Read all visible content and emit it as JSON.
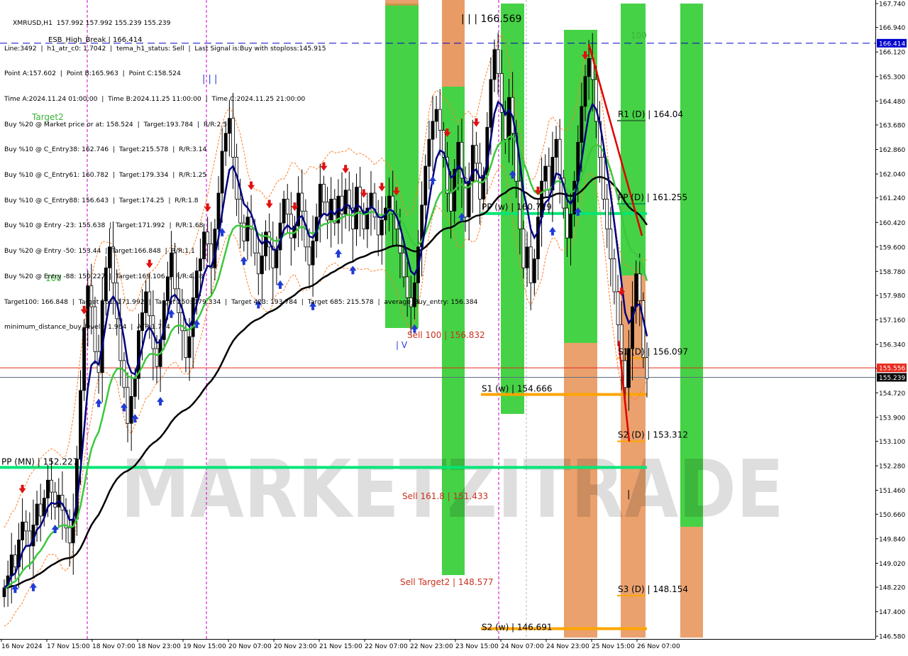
{
  "window": {
    "symbol_title": "XMRUSD,H1  157.992 157.992 155.239 155.239"
  },
  "info_panel": [
    "Line:3492  |  h1_atr_c0: 1.7042  |  tema_h1_status: Sell  |  Last Signal is:Buy with stoploss:145.915",
    "Point A:157.602  |  Point B:165.963  |  Point C:158.524",
    "Time A:2024.11.24 01:00:00  |  Time B:2024.11.25 11:00:00  |  Time C:2024.11.25 21:00:00",
    "Buy %20 @ Market price or at: 158.524  |  Target:193.784  |  R/R:2.57",
    "Buy %10 @ C_Entry38: 162.746  |  Target:215.578  |  R/R:3.14",
    "Buy %10 @ C_Entry61: 160.782  |  Target:179.334  |  R/R:1.25",
    "Buy %10 @ C_Entry88: 156.643  |  Target:174.25  |  R/R:1.8",
    "Buy %10 @ Entry -23: 155.638  |  Target:171.992  |  R/R:1.68",
    "Buy %20 @ Entry -50: 153.44  |  Target:166.848  |  R/R:1.1",
    "Buy %20 @ Entry -88: 150.227  |  Target:169.106  |  R/R:4.38",
    "Target100: 166.848  |  Target 161: 171.992  |  Target 250: 179.334  |  Target 423: 193.784  |  Target 685: 215.578  |  average_Buy_entry: 156.384",
    "minimum_distance_buy_levels: 1.964  |  ATR:1.704"
  ],
  "watermark": "MARKETZITRADE",
  "colors": {
    "background": "#ffffff",
    "bull_candle": "#000000",
    "green_zone": "#32cd32",
    "orange_zone": "#e5894a",
    "pivot_line": "#00e676",
    "support_line": "#ffa500",
    "ema_blue": "#00007f",
    "ma_green": "#3cc83c",
    "ma_black": "#000000",
    "trend_red": "#e00000",
    "band_orange": "#ff7f27",
    "sell_text": "#c8321e",
    "current_price_red": "#e8291c",
    "bid_line": "#5a6e82",
    "high_line_blue": "#0000cd"
  },
  "chart_data": {
    "type": "candlestick",
    "symbol": "XMRUSD",
    "timeframe": "H1",
    "ylim": [
      146.56,
      167.74
    ],
    "y_ticks": [
      "167.740",
      "166.940",
      "166.120",
      "165.300",
      "164.480",
      "163.680",
      "162.860",
      "162.040",
      "161.240",
      "160.420",
      "159.600",
      "158.780",
      "157.980",
      "157.160",
      "156.340",
      "155.540",
      "154.720",
      "153.900",
      "153.100",
      "152.280",
      "151.460",
      "150.660",
      "149.840",
      "149.020",
      "148.220",
      "147.400",
      "146.580"
    ],
    "x_labels": [
      "16 Nov 2024",
      "17 Nov 15:00",
      "18 Nov 07:00",
      "18 Nov 23:00",
      "19 Nov 15:00",
      "20 Nov 07:00",
      "20 Nov 23:00",
      "21 Nov 15:00",
      "22 Nov 07:00",
      "22 Nov 23:00",
      "23 Nov 15:00",
      "24 Nov 07:00",
      "24 Nov 23:00",
      "25 Nov 15:00",
      "26 Nov 07:00"
    ],
    "price_tags": [
      {
        "label": "166.414",
        "value": 166.414,
        "color": "#0000cd"
      },
      {
        "label": "155.556",
        "value": 155.556,
        "color": "#e8291c"
      },
      {
        "label": "155.239",
        "value": 155.239,
        "color": "#0a0a0a"
      }
    ],
    "level_lines": [
      {
        "label": "PP (MN) | 152.227",
        "value": 152.227
      },
      {
        "label": "PP (w) | 160.719",
        "value": 160.719
      },
      {
        "label": "S1 (w) | 154.666",
        "value": 154.666
      },
      {
        "label": "S2 (w) | 146.691",
        "value": 146.691
      },
      {
        "label": "R1 (D) | 164.04",
        "value": 164.04
      },
      {
        "label": "PP (D) | 161.255",
        "value": 161.255
      },
      {
        "label": "S1 (D) | 156.097",
        "value": 156.097
      },
      {
        "label": "S2 (D) | 153.312",
        "value": 153.312
      },
      {
        "label": "S3 (D) | 148.154",
        "value": 148.154
      }
    ],
    "text_annotations": [
      {
        "text": "| | | 166.569",
        "value": 166.569
      },
      {
        "text": "Sell 100 | 156.832",
        "value": 156.832
      },
      {
        "text": "Sell 161.8 | 151.433",
        "value": 151.433
      },
      {
        "text": "Sell Target2 | 148.577",
        "value": 148.577
      },
      {
        "text": "ESB_High_Break | 166.414",
        "value": 166.414
      },
      {
        "text": "100"
      },
      {
        "text": "100"
      },
      {
        "text": "Target2"
      },
      {
        "text": "| | |"
      },
      {
        "text": "| V"
      },
      {
        "text": "|"
      }
    ],
    "grid": false,
    "series": {
      "closes": [
        148.2,
        148.6,
        149.3,
        148.9,
        149.8,
        150.4,
        150.1,
        149.6,
        150.3,
        151.0,
        150.6,
        151.2,
        151.8,
        151.4,
        150.9,
        151.3,
        150.8,
        150.2,
        149.7,
        150.5,
        152.5,
        154.8,
        156.9,
        158.3,
        157.6,
        156.1,
        155.4,
        157.8,
        158.9,
        159.6,
        158.4,
        157.2,
        155.8,
        154.9,
        153.7,
        154.6,
        155.2,
        156.8,
        157.4,
        158.1,
        157.3,
        156.2,
        155.6,
        156.5,
        157.8,
        158.6,
        159.4,
        158.2,
        157.4,
        156.8,
        155.9,
        156.6,
        157.9,
        158.8,
        159.2,
        160.1,
        159.7,
        158.9,
        160.2,
        161.4,
        162.8,
        163.4,
        163.9,
        162.6,
        161.2,
        160.4,
        159.8,
        160.6,
        160.2,
        159.4,
        158.7,
        159.3,
        160.1,
        159.6,
        158.9,
        159.5,
        160.4,
        161.2,
        160.7,
        159.9,
        160.3,
        161.4,
        160.8,
        159.6,
        159.0,
        159.8,
        160.6,
        161.7,
        161.1,
        160.5,
        161.2,
        160.4,
        161.3,
        160.7,
        161.5,
        160.9,
        160.2,
        161.6,
        160.8,
        160.2,
        160.9,
        161.4,
        160.6,
        160.0,
        160.5,
        160.9,
        161.3,
        160.7,
        160.2,
        159.4,
        158.6,
        157.9,
        157.6,
        158.4,
        159.6,
        161.0,
        162.3,
        163.2,
        163.8,
        164.2,
        163.5,
        162.6,
        161.4,
        160.8,
        162.2,
        163.1,
        161.9,
        160.6,
        161.8,
        163.0,
        162.4,
        161.2,
        162.0,
        163.6,
        165.2,
        166.2,
        165.4,
        164.1,
        163.2,
        164.6,
        163.4,
        161.8,
        160.2,
        158.9,
        159.6,
        158.4,
        159.2,
        160.6,
        161.8,
        162.3,
        161.5,
        162.6,
        163.2,
        161.9,
        160.9,
        159.9,
        160.7,
        161.8,
        163.1,
        164.3,
        165.3,
        165.9,
        165.2,
        163.8,
        162.6,
        161.2,
        160.2,
        159.2,
        158.1,
        157.0,
        155.8,
        154.9,
        156.2,
        157.6,
        158.7,
        157.8,
        155.9,
        155.2
      ]
    }
  }
}
